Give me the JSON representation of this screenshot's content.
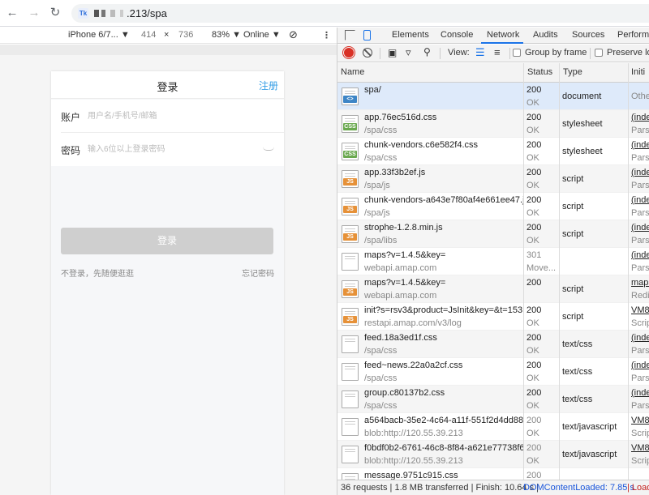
{
  "browser": {
    "url_tail": ".213/spa",
    "favicon_label": "Tk"
  },
  "device_toolbar": {
    "device": "iPhone 6/7...",
    "width": "414",
    "times": "×",
    "height": "736",
    "zoom": "83%",
    "network": "Online"
  },
  "mobile_page": {
    "title": "登录",
    "register": "注册",
    "account_label": "账户",
    "account_placeholder": "用户名/手机号/邮箱",
    "password_label": "密码",
    "password_placeholder": "输入6位以上登录密码",
    "login_button": "登录",
    "guest_link": "不登录，先随便逛逛",
    "forgot_link": "忘记密码"
  },
  "devtools": {
    "tabs": [
      "Elements",
      "Console",
      "Network",
      "Audits",
      "Sources",
      "Performa"
    ],
    "active_tab": "Network",
    "toolbar": {
      "view_label": "View:",
      "group_by_frame": "Group by frame",
      "preserve_log": "Preserve lo"
    },
    "columns": {
      "name": "Name",
      "status": "Status",
      "type": "Type",
      "initiator": "Initi"
    },
    "rows": [
      {
        "icon": "doc",
        "name": "spa/",
        "path": "",
        "status": "200",
        "status_text": "OK",
        "type": "document",
        "initiator": "",
        "initiator_sub": "Othe"
      },
      {
        "icon": "css",
        "name": "app.76ec516d.css",
        "path": "/spa/css",
        "status": "200",
        "status_text": "OK",
        "type": "stylesheet",
        "initiator": "(inde",
        "initiator_sub": "Parse"
      },
      {
        "icon": "css",
        "name": "chunk-vendors.c6e582f4.css",
        "path": "/spa/css",
        "status": "200",
        "status_text": "OK",
        "type": "stylesheet",
        "initiator": "(inde",
        "initiator_sub": "Parse"
      },
      {
        "icon": "js",
        "name": "app.33f3b2ef.js",
        "path": "/spa/js",
        "status": "200",
        "status_text": "OK",
        "type": "script",
        "initiator": "(inde",
        "initiator_sub": "Parse"
      },
      {
        "icon": "js",
        "name": "chunk-vendors-a643e7f80af4e661ee47.js",
        "path": "/spa/js",
        "status": "200",
        "status_text": "OK",
        "type": "script",
        "initiator": "(inde",
        "initiator_sub": "Parse"
      },
      {
        "icon": "js",
        "name": "strophe-1.2.8.min.js",
        "path": "/spa/libs",
        "status": "200",
        "status_text": "OK",
        "type": "script",
        "initiator": "(inde",
        "initiator_sub": "Parse"
      },
      {
        "icon": "blank",
        "name": "maps?v=1.4.5&key=",
        "path": "webapi.amap.com",
        "status": "301",
        "status_text": "Move...",
        "type": "",
        "initiator": "(inde",
        "initiator_sub": "Parse"
      },
      {
        "icon": "js",
        "name": "maps?v=1.4.5&key=",
        "path": "webapi.amap.com",
        "status": "200",
        "status_text": "",
        "type": "script",
        "initiator": "maps",
        "initiator_sub": "Redir"
      },
      {
        "icon": "js",
        "name": "init?s=rsv3&product=JsInit&key=&t=153...",
        "path": "restapi.amap.com/v3/log",
        "status": "200",
        "status_text": "OK",
        "type": "script",
        "initiator": "VM8",
        "initiator_sub": "Scrip"
      },
      {
        "icon": "blank",
        "name": "feed.18a3ed1f.css",
        "path": "/spa/css",
        "status": "200",
        "status_text": "OK",
        "type": "text/css",
        "initiator": "(inde",
        "initiator_sub": "Parse"
      },
      {
        "icon": "blank",
        "name": "feed~news.22a0a2cf.css",
        "path": "/spa/css",
        "status": "200",
        "status_text": "OK",
        "type": "text/css",
        "initiator": "(inde",
        "initiator_sub": "Parse"
      },
      {
        "icon": "blank",
        "name": "group.c80137b2.css",
        "path": "/spa/css",
        "status": "200",
        "status_text": "OK",
        "type": "text/css",
        "initiator": "(inde",
        "initiator_sub": "Parse"
      },
      {
        "icon": "blank",
        "name": "a564bacb-35e2-4c64-a11f-551f2d4dd885",
        "path": "blob:http://120.55.39.213",
        "status": "200",
        "status_text": "OK",
        "type": "text/javascript",
        "initiator": "VM8",
        "initiator_sub": "Scrip"
      },
      {
        "icon": "blank",
        "name": "f0bdf0b2-6761-46c8-8f84-a621e77738f6",
        "path": "blob:http://120.55.39.213",
        "status": "200",
        "status_text": "OK",
        "type": "text/javascript",
        "initiator": "VM8",
        "initiator_sub": "Scrip"
      },
      {
        "icon": "blank",
        "name": "message.9751c915.css",
        "path": "",
        "status": "200",
        "status_text": "",
        "type": "",
        "initiator": "",
        "initiator_sub": ""
      }
    ],
    "status_bar": {
      "summary": "36 requests | 1.8 MB transferred | Finish: 10.64 s |",
      "dom_content": "DOMContentLoaded: 7.85 s",
      "load": "| Load"
    }
  }
}
